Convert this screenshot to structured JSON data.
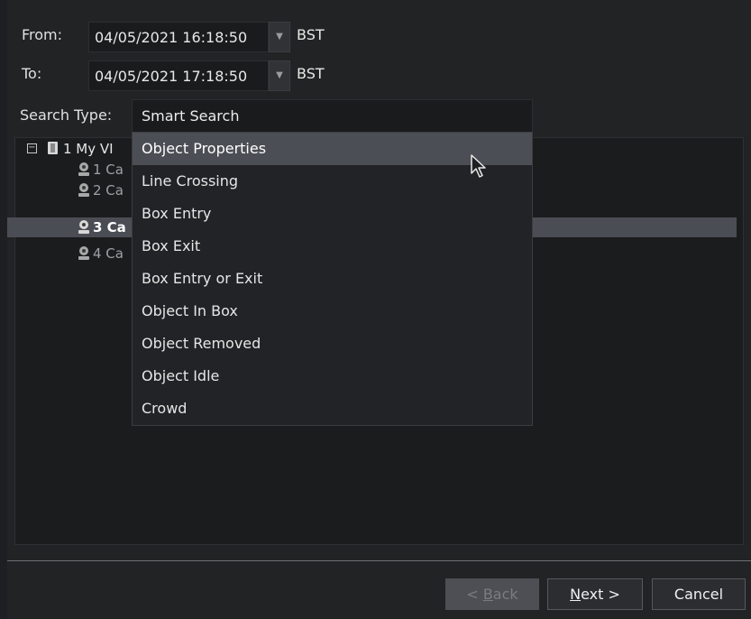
{
  "form": {
    "from_label": "From:",
    "from_value": "04/05/2021 16:18:50",
    "from_tz": "BST",
    "to_label": "To:",
    "to_value": "04/05/2021 17:18:50",
    "to_tz": "BST",
    "search_type_label": "Search Type:",
    "search_type_value": "Smart Search"
  },
  "tree": {
    "root_label": "1 My VI",
    "items": [
      {
        "label": "1 Ca",
        "selected": false
      },
      {
        "label": "2 Ca",
        "selected": false
      },
      {
        "label": "3 Ca",
        "selected": true
      },
      {
        "label": "4 Ca",
        "selected": false
      }
    ]
  },
  "dropdown": {
    "highlighted_index": 0,
    "options": [
      "Object Properties",
      "Line Crossing",
      "Box Entry",
      "Box Exit",
      "Box Entry or Exit",
      "Object In Box",
      "Object Removed",
      "Object Idle",
      "Crowd"
    ]
  },
  "footer": {
    "back_prefix": "< ",
    "back_mnemonic": "B",
    "back_rest": "ack",
    "next_mnemonic": "N",
    "next_rest": "ext >",
    "cancel_label": "Cancel"
  },
  "colors": {
    "background": "#1e1f22",
    "highlight": "#4b4e55",
    "selected_row": "#4a4d54"
  },
  "icons": {
    "expander": "minus-box-icon",
    "root": "server-icon",
    "camera": "webcam-icon",
    "dropdown_arrow": "chevron-down-icon",
    "cursor": "mouse-pointer-icon"
  }
}
